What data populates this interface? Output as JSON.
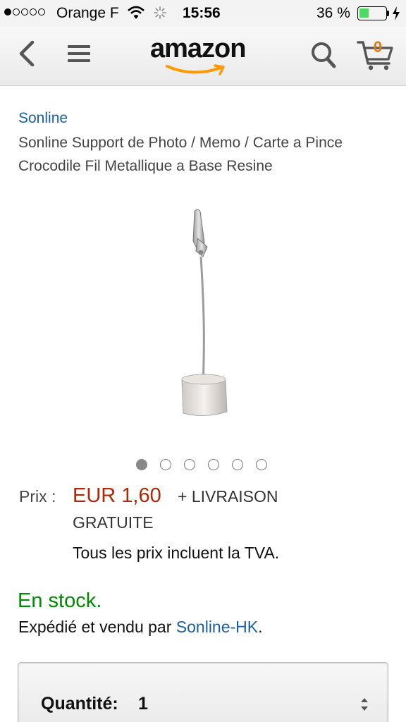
{
  "status_bar": {
    "carrier": "Orange F",
    "time": "15:56",
    "battery_percent": "36 %",
    "battery_level": 0.36,
    "signal_bars_filled": 1,
    "signal_bars_total": 5,
    "battery_color": "#4cd964"
  },
  "nav": {
    "logo_text": "amazon",
    "cart_count": "0",
    "icons": [
      "chevron-left-icon",
      "hamburger-menu-icon",
      "search-icon",
      "cart-icon"
    ],
    "logo_smile_color": "#f90"
  },
  "product": {
    "brand": "Sonline",
    "title": "Sonline Support de Photo / Memo / Carte a Pince Crocodile Fil Metallique a Base Resine",
    "image_count": 6,
    "active_image": 0
  },
  "price": {
    "label": "Prix :",
    "value": "EUR 1,60",
    "shipping_line1": "+ LIVRAISON",
    "shipping_line2": "GRATUITE",
    "vat_note": "Tous les prix incluent la TVA.",
    "price_color": "#b12704"
  },
  "availability": {
    "status": "En stock.",
    "shipped_prefix": "Expédié et vendu par ",
    "seller": "Sonline-HK",
    "suffix": ".",
    "status_color": "#008a00",
    "link_color": "#1a5fa0"
  },
  "quantity": {
    "label": "Quantité:",
    "value": "1"
  }
}
